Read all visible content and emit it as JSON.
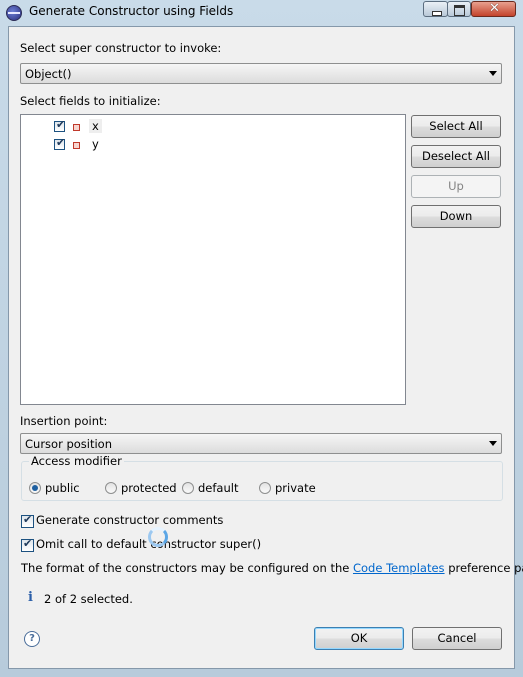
{
  "window": {
    "title": "Generate Constructor using Fields",
    "icon": "eclipse-icon"
  },
  "super_constructor": {
    "label": "Select super constructor to invoke:",
    "selected": "Object()"
  },
  "fields": {
    "label": "Select fields to initialize:",
    "items": [
      {
        "name": "x",
        "checked": true,
        "icon": "field-private-icon"
      },
      {
        "name": "y",
        "checked": true,
        "icon": "field-private-icon"
      }
    ]
  },
  "buttons": {
    "select_all": "Select All",
    "deselect_all": "Deselect All",
    "up": "Up",
    "down": "Down",
    "ok": "OK",
    "cancel": "Cancel"
  },
  "insertion": {
    "label": "Insertion point:",
    "selected": "Cursor position"
  },
  "access": {
    "label": "Access modifier",
    "options": [
      "public",
      "protected",
      "default",
      "private"
    ],
    "selected": "public"
  },
  "options": {
    "generate_comments": {
      "label": "Generate constructor comments",
      "checked": true
    },
    "omit_super": {
      "label": "Omit call to default constructor super()",
      "checked": true
    }
  },
  "format_note": {
    "before": "The format of the constructors may be configured on the ",
    "link": "Code Templates",
    "after": " preference page."
  },
  "status": "2 of 2 selected.",
  "colors": {
    "link": "#0066cc",
    "title_gradient_top": "#c9dbe9",
    "close_button": "#c3432b"
  }
}
